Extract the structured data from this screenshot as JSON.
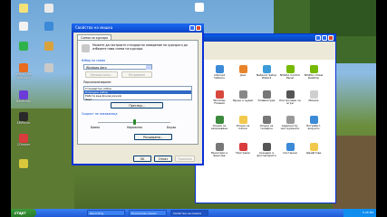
{
  "desktop": {
    "icons": [
      {
        "label": "",
        "color": "#f7e27a"
      },
      {
        "label": "",
        "color": "#eaeaea"
      },
      {
        "label": "",
        "color": "#f2f2f2"
      },
      {
        "label": "",
        "color": "#3c8ad8"
      },
      {
        "label": "",
        "color": "#2fb24a"
      },
      {
        "label": "",
        "color": "#d8a23c"
      },
      {
        "label": "avast! Free Antivirus",
        "color": "#e86b1f"
      },
      {
        "label": "",
        "color": "#c9c9c9"
      },
      {
        "label": "Bandicam",
        "color": "#6b3cd8"
      },
      {
        "label": "KMPlayer",
        "color": "#2a2a2a"
      },
      {
        "label": "CCleaner",
        "color": "#d83c3c"
      },
      {
        "label": "",
        "color": "#d8c83c"
      }
    ],
    "top_icon": {
      "label": "",
      "color": "#ffffff"
    }
  },
  "mouse_dialog": {
    "title": "Свойства на мишка",
    "tabs": [
      "Схеми на курсора"
    ],
    "description": "Можете да настроите стандартно поведение на курсора и да изберете нова схема на курсори.",
    "scheme_group": "Избор на схема",
    "scheme_value": "Windows Aero",
    "save_as_label": "Запиши като...",
    "delete_label": "Изтриване",
    "customize_label": "Персонализиране:",
    "list_rows": [
      {
        "text": "Стандартен избор",
        "highlighted": false
      },
      {
        "text": "Помощен избор",
        "highlighted": true
      },
      {
        "text": "Работа във фонов режим",
        "highlighted": false
      },
      {
        "text": "Зает",
        "highlighted": false
      }
    ],
    "browse_button": "Преглед...",
    "speed_group": "Скорост на показалеца",
    "slider_min": "Бавно",
    "slider_mid": "Нормална",
    "slider_max": "Бързо",
    "slider_value": 0.5,
    "advanced_button": "Разширени...",
    "ok_button": "OK",
    "cancel_button": "Отказ",
    "apply_button": "Приложи"
  },
  "control_panel": {
    "items": [
      {
        "label": "Internet Options",
        "color": "#3c8ad8"
      },
      {
        "label": "Java",
        "color": "#e8832a"
      },
      {
        "label": "Network Setup Wizard",
        "color": "#3c9bd8"
      },
      {
        "label": "NVIDIA Control Panel",
        "color": "#76b900"
      },
      {
        "label": "NVIDIA nView Desktop",
        "color": "#76b900"
      },
      {
        "label": "Windows Firewall",
        "color": "#d8473c"
      },
      {
        "label": "Звуци и аудио",
        "color": "#888888"
      },
      {
        "label": "Клавиатура",
        "color": "#777777"
      },
      {
        "label": "Контролери за игри",
        "color": "#555555"
      },
      {
        "label": "Мишка",
        "color": "#cfcfcf"
      },
      {
        "label": "Опции за захранване",
        "color": "#3c8a3c"
      },
      {
        "label": "Опции за папки",
        "color": "#f2c94c"
      },
      {
        "label": "Опции за телефон",
        "color": "#777777"
      },
      {
        "label": "Администр. инструменти",
        "color": "#999999"
      },
      {
        "label": "Потребит. акаунти",
        "color": "#3c8ad8"
      },
      {
        "label": "Принтери и факсове",
        "color": "#777777"
      },
      {
        "label": "Програми",
        "color": "#d83c3c"
      },
      {
        "label": "Скенери и фотоапарати",
        "color": "#555555"
      },
      {
        "label": "Системни",
        "color": "#3c8ad8"
      },
      {
        "label": "Шрифтове",
        "color": "#f2c94c"
      }
    ]
  },
  "taskbar": {
    "start_label": "старт",
    "tasks": [
      "Recording",
      "Контролен панел",
      "Свойства на мишка"
    ],
    "clock": "5:26 PM"
  }
}
